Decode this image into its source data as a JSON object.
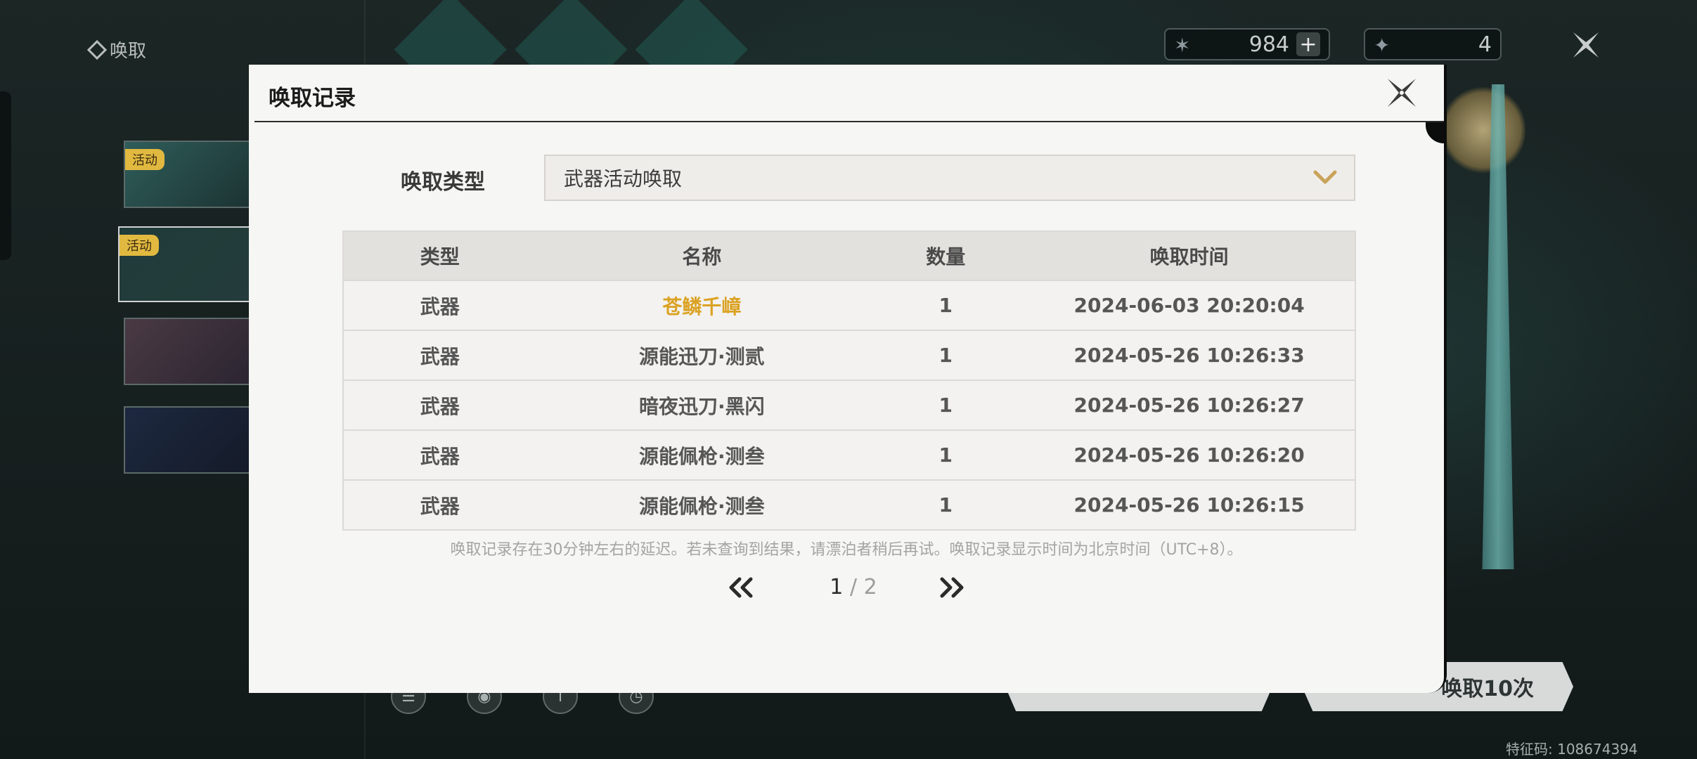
{
  "background": {
    "section_label": "唤取",
    "banners": [
      {
        "tag": "活动"
      },
      {
        "tag": "活动"
      },
      {
        "tag": ""
      },
      {
        "tag": ""
      }
    ],
    "currency_astrite": "984",
    "currency_tide": "4",
    "draw_10_label": "唤取10次",
    "uid_text": "特征码: 108674394"
  },
  "modal": {
    "title": "唤取记录",
    "type_label": "唤取类型",
    "type_selected": "武器活动唤取",
    "table": {
      "headers": [
        "类型",
        "名称",
        "数量",
        "唤取时间"
      ],
      "rows": [
        {
          "type": "武器",
          "name": "苍鳞千嶂",
          "qty": "1",
          "time": "2024-06-03 20:20:04",
          "rarity_color": "#dba223"
        },
        {
          "type": "武器",
          "name": "源能迅刀·测贰",
          "qty": "1",
          "time": "2024-05-26 10:26:33"
        },
        {
          "type": "武器",
          "name": "暗夜迅刀·黑闪",
          "qty": "1",
          "time": "2024-05-26 10:26:27"
        },
        {
          "type": "武器",
          "name": "源能佩枪·测叁",
          "qty": "1",
          "time": "2024-05-26 10:26:20"
        },
        {
          "type": "武器",
          "name": "源能佩枪·测叁",
          "qty": "1",
          "time": "2024-05-26 10:26:15"
        }
      ]
    },
    "note": "唤取记录存在30分钟左右的延迟。若未查询到结果，请漂泊者稍后再试。唤取记录显示时间为北京时间（UTC+8）。",
    "pager": {
      "current": "1",
      "separator": "/",
      "total": "2"
    }
  },
  "colors": {
    "accent_gold": "#dba223",
    "chevron": "#c9a35a"
  }
}
